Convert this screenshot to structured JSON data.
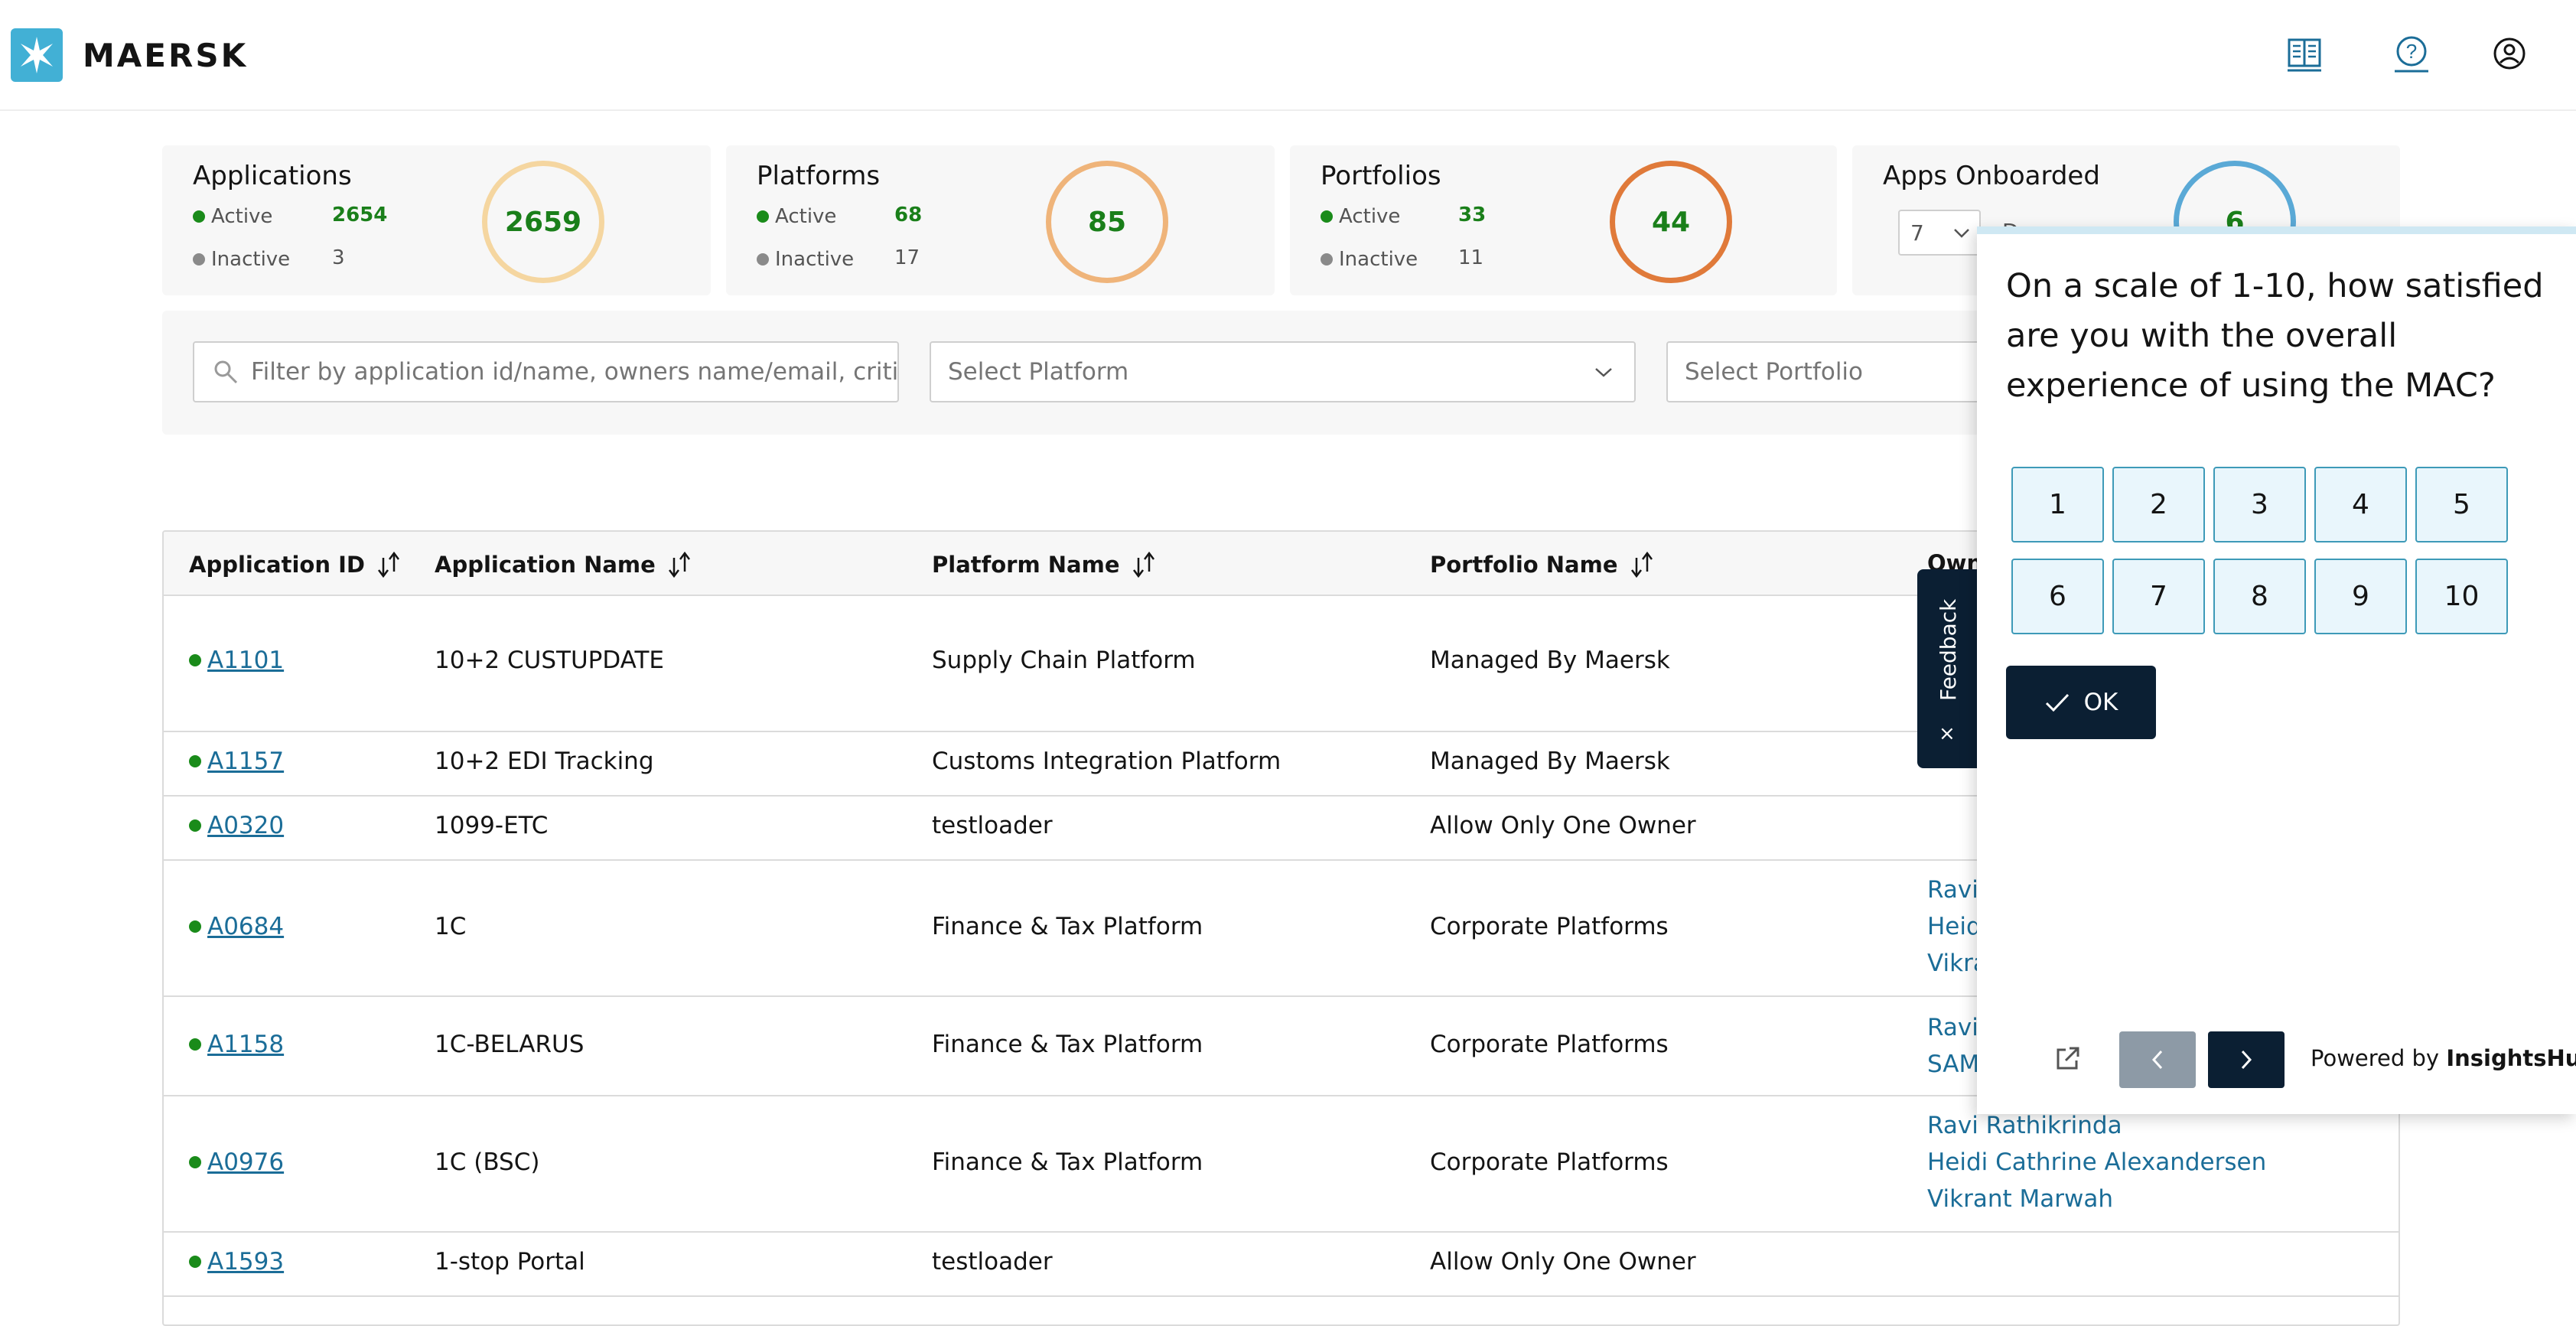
{
  "header": {
    "logo_text": "MAERSK",
    "icons": [
      "book-icon",
      "help-icon",
      "user-profile-icon"
    ]
  },
  "stats": {
    "applications": {
      "title": "Applications",
      "active_label": "Active",
      "active": "2654",
      "inactive_label": "Inactive",
      "inactive": "3",
      "total": "2659",
      "ring_color": "#f5d6a0"
    },
    "platforms": {
      "title": "Platforms",
      "active_label": "Active",
      "active": "68",
      "inactive_label": "Inactive",
      "inactive": "17",
      "total": "85",
      "ring_color": "#efb47a"
    },
    "portfolios": {
      "title": "Portfolios",
      "active_label": "Active",
      "active": "33",
      "inactive_label": "Inactive",
      "inactive": "11",
      "total": "44",
      "ring_color": "#e07a3a"
    },
    "onboarded": {
      "title": "Apps Onboarded",
      "select_value": "7",
      "partial_text": "D",
      "total": "6",
      "ring_color": "#5aa9d6"
    }
  },
  "filters": {
    "search_placeholder": "Filter by application id/name, owners name/email, criticality",
    "platform_placeholder": "Select Platform",
    "portfolio_placeholder": "Select Portfolio"
  },
  "table": {
    "columns": [
      "Application ID",
      "Application Name",
      "Platform Name",
      "Portfolio Name",
      "Owners"
    ],
    "rows": [
      {
        "id": "A1101",
        "name": "10+2 CUSTUPDATE",
        "platform": "Supply Chain Platform",
        "portfolio": "Managed By Maersk",
        "owners": []
      },
      {
        "id": "A1157",
        "name": "10+2 EDI Tracking",
        "platform": "Customs Integration Platform",
        "portfolio": "Managed By Maersk",
        "owners": []
      },
      {
        "id": "A0320",
        "name": "1099-ETC",
        "platform": "testloader",
        "portfolio": "Allow Only One Owner",
        "owners": []
      },
      {
        "id": "A0684",
        "name": "1C",
        "platform": "Finance & Tax Platform",
        "portfolio": "Corporate Platforms",
        "owners": [
          "Ravi",
          "Heidi",
          "Vikra"
        ]
      },
      {
        "id": "A1158",
        "name": "1C-BELARUS",
        "platform": "Finance & Tax Platform",
        "portfolio": "Corporate Platforms",
        "owners": [
          "Ravi",
          "SAM"
        ]
      },
      {
        "id": "A0976",
        "name": "1C (BSC)",
        "platform": "Finance & Tax Platform",
        "portfolio": "Corporate Platforms",
        "owners": [
          "Ravi Rathikrinda",
          "Heidi Cathrine Alexandersen",
          "Vikrant Marwah"
        ]
      },
      {
        "id": "A1593",
        "name": "1-stop Portal",
        "platform": "testloader",
        "portfolio": "Allow Only One Owner",
        "owners": []
      }
    ]
  },
  "feedback_tab": {
    "label": "Feedback",
    "close": "×"
  },
  "survey": {
    "question": "On a scale of 1-10, how satisfied are you with the overall experience of using the MAC?",
    "ratings": [
      "1",
      "2",
      "3",
      "4",
      "5",
      "6",
      "7",
      "8",
      "9",
      "10"
    ],
    "ok_label": "OK",
    "powered_prefix": "Powered by ",
    "powered_brand": "InsightsHub"
  },
  "colors": {
    "brand_blue": "#42b0d5",
    "link_blue": "#1b6d98",
    "active_green": "#1a7f1a",
    "dark_navy": "#0b1f33",
    "rating_border": "#3e9ab8"
  }
}
